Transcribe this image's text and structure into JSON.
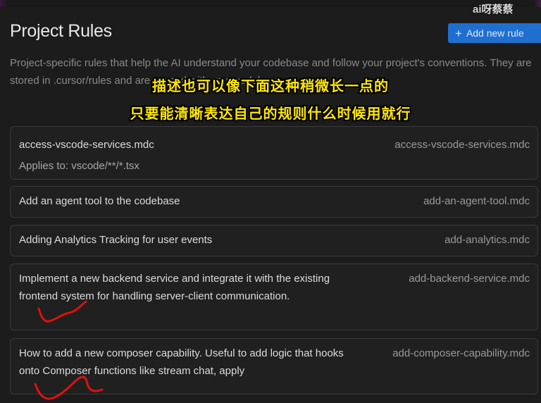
{
  "header": {
    "title": "Project Rules",
    "add_button_label": "Add new rule",
    "description": "Project-specific rules that help the AI understand your codebase and follow your project's conventions. They are stored in .cursor/rules and are synced with your codebase"
  },
  "watermark": "ai呀蔡蔡",
  "overlay_captions": {
    "line1": "描述也可以像下面这种稍微长一点的",
    "line2": "只要能清晰表达自己的规则什么时候用就行"
  },
  "rules": [
    {
      "description": "access-vscode-services.mdc",
      "file": "access-vscode-services.mdc",
      "applies_to": "Applies to: vscode/**/*.tsx"
    },
    {
      "description": "Add an agent tool to the codebase",
      "file": "add-an-agent-tool.mdc"
    },
    {
      "description": "Adding Analytics Tracking for user events",
      "file": "add-analytics.mdc"
    },
    {
      "description": "Implement a new backend service and integrate it with the existing frontend system for handling server-client communication.",
      "file": "add-backend-service.mdc"
    },
    {
      "description": "How to add a new composer capability. Useful to add logic that hooks onto Composer functions like stream chat, apply",
      "file": "add-composer-capability.mdc"
    }
  ],
  "colors": {
    "accent": "#1f6fd1",
    "overlay_text": "#ffe600",
    "annotation": "#e01010"
  },
  "icons": {
    "add_button": "plus-icon"
  }
}
